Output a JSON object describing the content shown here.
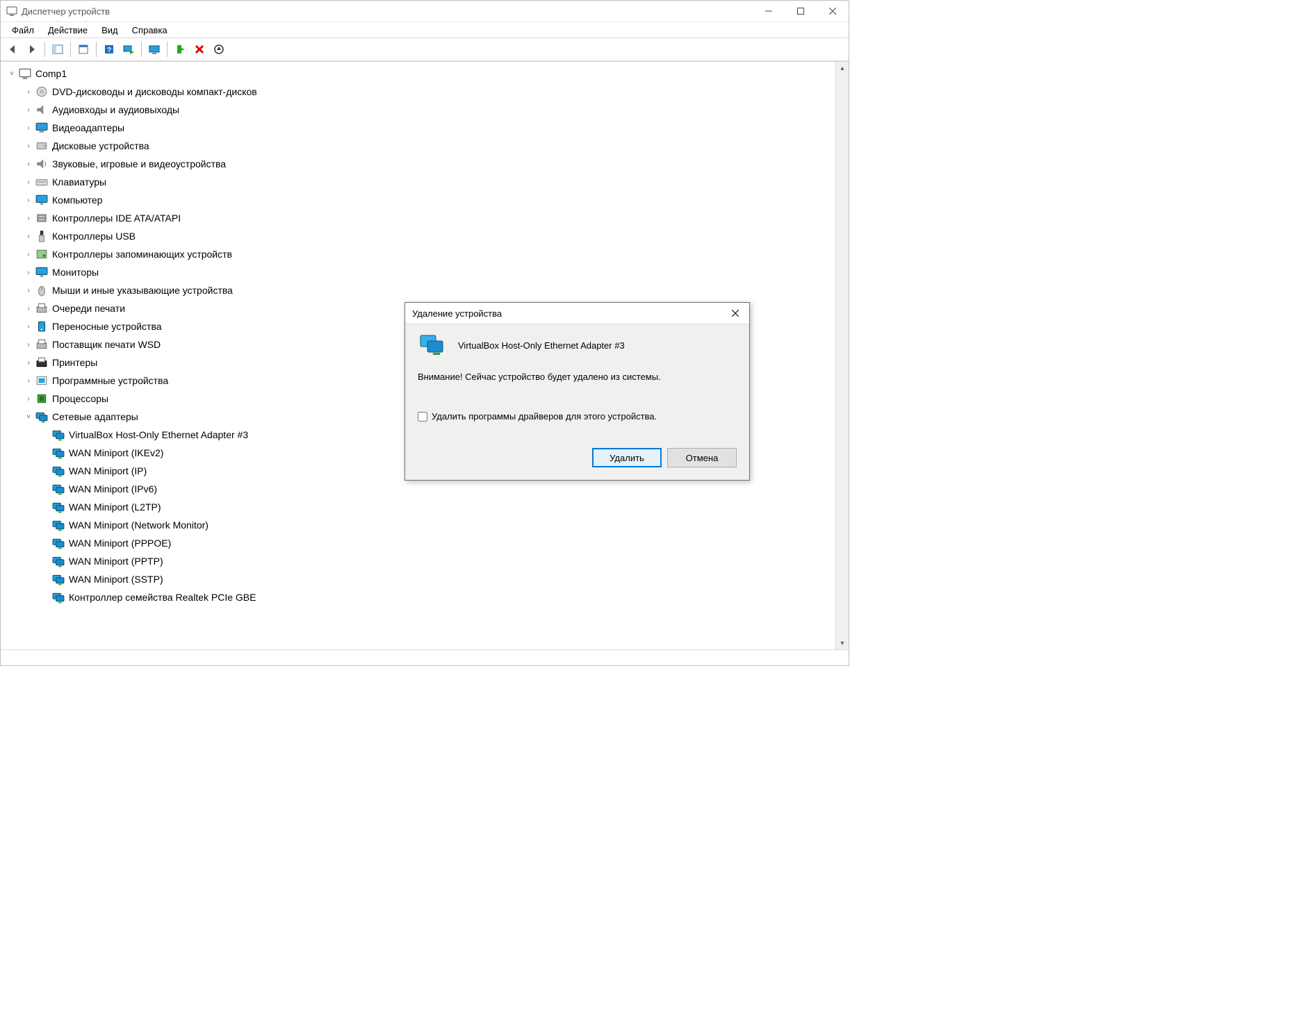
{
  "window": {
    "title": "Диспетчер устройств",
    "menus": [
      "Файл",
      "Действие",
      "Вид",
      "Справка"
    ],
    "toolbar_icons": [
      "back",
      "forward",
      "sep",
      "show-panel",
      "sep",
      "properties",
      "sep",
      "help",
      "scan",
      "sep",
      "monitor",
      "sep",
      "enable",
      "delete",
      "eject"
    ]
  },
  "tree": {
    "root": "Comp1",
    "categories": [
      {
        "icon": "dvd",
        "label": "DVD-дисководы и дисководы компакт-дисков",
        "expanded": false
      },
      {
        "icon": "audio",
        "label": "Аудиовходы и аудиовыходы",
        "expanded": false
      },
      {
        "icon": "display",
        "label": "Видеоадаптеры",
        "expanded": false
      },
      {
        "icon": "disk",
        "label": "Дисковые устройства",
        "expanded": false
      },
      {
        "icon": "sound",
        "label": "Звуковые, игровые и видеоустройства",
        "expanded": false
      },
      {
        "icon": "keyboard",
        "label": "Клавиатуры",
        "expanded": false
      },
      {
        "icon": "computer",
        "label": "Компьютер",
        "expanded": false
      },
      {
        "icon": "ide",
        "label": "Контроллеры IDE ATA/ATAPI",
        "expanded": false
      },
      {
        "icon": "usb",
        "label": "Контроллеры USB",
        "expanded": false
      },
      {
        "icon": "storage",
        "label": "Контроллеры запоминающих устройств",
        "expanded": false
      },
      {
        "icon": "monitor",
        "label": "Мониторы",
        "expanded": false
      },
      {
        "icon": "mouse",
        "label": "Мыши и иные указывающие устройства",
        "expanded": false
      },
      {
        "icon": "printq",
        "label": "Очереди печати",
        "expanded": false
      },
      {
        "icon": "portable",
        "label": "Переносные устройства",
        "expanded": false
      },
      {
        "icon": "printprov",
        "label": "Поставщик печати WSD",
        "expanded": false
      },
      {
        "icon": "printer",
        "label": "Принтеры",
        "expanded": false
      },
      {
        "icon": "software",
        "label": "Программные устройства",
        "expanded": false
      },
      {
        "icon": "cpu",
        "label": "Процессоры",
        "expanded": false
      },
      {
        "icon": "network",
        "label": "Сетевые адаптеры",
        "expanded": true,
        "children": [
          "VirtualBox Host-Only Ethernet Adapter #3",
          "WAN Miniport (IKEv2)",
          "WAN Miniport (IP)",
          "WAN Miniport (IPv6)",
          "WAN Miniport (L2TP)",
          "WAN Miniport (Network Monitor)",
          "WAN Miniport (PPPOE)",
          "WAN Miniport (PPTP)",
          "WAN Miniport (SSTP)",
          "Контроллер семейства Realtek PCIe GBE"
        ]
      }
    ]
  },
  "dialog": {
    "title": "Удаление устройства",
    "device": "VirtualBox Host-Only Ethernet Adapter #3",
    "warning": "Внимание! Сейчас устройство будет удалено из системы.",
    "checkbox_label": "Удалить программы драйверов для этого устройства.",
    "checkbox_checked": false,
    "ok_label": "Удалить",
    "cancel_label": "Отмена"
  }
}
